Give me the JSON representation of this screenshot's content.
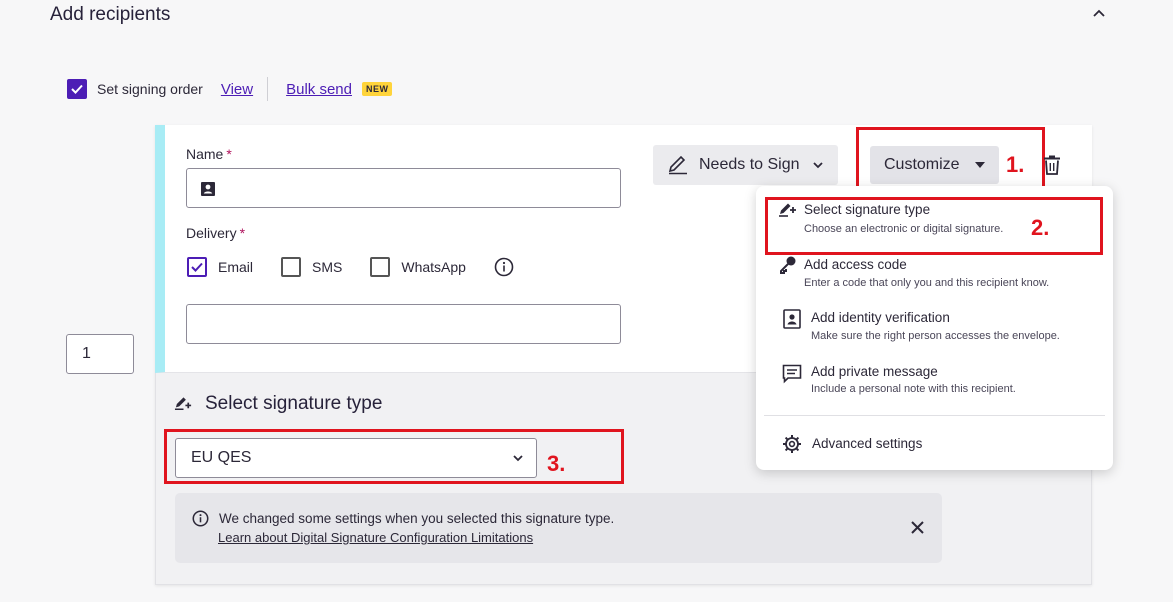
{
  "section": {
    "title": "Add recipients"
  },
  "signing_order": {
    "label": "Set signing order",
    "checked": true,
    "view_link": "View",
    "bulk_send_link": "Bulk send",
    "new_badge": "NEW"
  },
  "recipient": {
    "order_value": "1",
    "name_label": "Name",
    "name_required": "*",
    "delivery_label": "Delivery",
    "delivery_required": "*",
    "delivery_options": [
      {
        "label": "Email",
        "checked": true
      },
      {
        "label": "SMS",
        "checked": false
      },
      {
        "label": "WhatsApp",
        "checked": false
      }
    ],
    "action_label": "Needs to Sign",
    "customize_label": "Customize"
  },
  "customize_menu": {
    "items": [
      {
        "title": "Select signature type",
        "desc": "Choose an electronic or digital signature.",
        "icon": "signature-pen-icon"
      },
      {
        "title": "Add access code",
        "desc": "Enter a code that only you and this recipient know.",
        "icon": "key-icon"
      },
      {
        "title": "Add identity verification",
        "desc": "Make sure the right person accesses the envelope.",
        "icon": "id-badge-icon"
      },
      {
        "title": "Add private message",
        "desc": "Include a personal note with this recipient.",
        "icon": "message-icon"
      }
    ],
    "advanced": "Advanced settings"
  },
  "signature_type": {
    "title": "Select signature type",
    "selected": "EU QES",
    "notice_text": "We changed some settings when you selected this signature type.",
    "notice_link": "Learn about Digital Signature Configuration Limitations"
  },
  "annotations": {
    "step1": "1.",
    "step2": "2.",
    "step3": "3."
  },
  "colors": {
    "accent": "#4c1db5",
    "annotation": "#e0141e",
    "recipient_strip": "#a8ecf5",
    "required": "#b0125c"
  }
}
